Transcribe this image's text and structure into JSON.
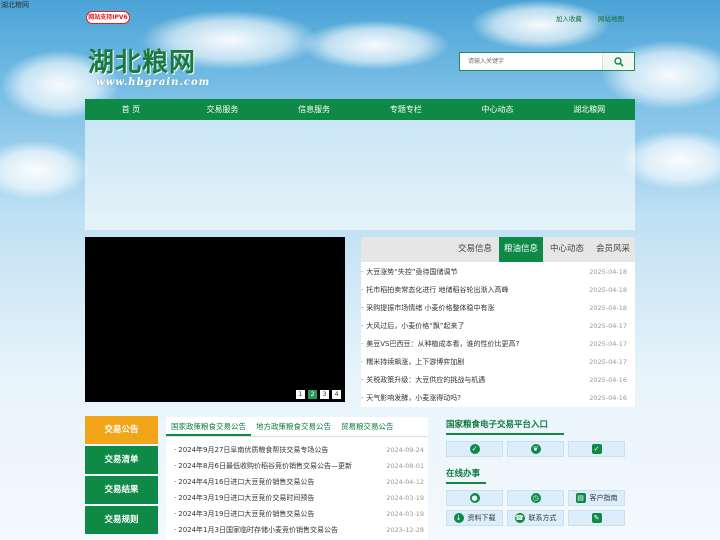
{
  "window_title": "湖北粮网",
  "badge": "网站支持IPV6",
  "toplinks": [
    "加入收藏",
    "网站地图"
  ],
  "logo": {
    "cn": "湖北粮网",
    "en": "www.hbgrain.com"
  },
  "search": {
    "placeholder": "请输入关键字",
    "icon": "search-icon"
  },
  "nav": [
    "首 页",
    "交易服务",
    "信息服务",
    "专题专栏",
    "中心动态",
    "湖北粮网"
  ],
  "video": {
    "pages": [
      "1",
      "2",
      "3",
      "4"
    ],
    "current_page": "2"
  },
  "news": {
    "tabs": [
      "交易信息",
      "粮油信息",
      "中心动态",
      "会员风采"
    ],
    "active_tab": "粮油信息",
    "items": [
      {
        "title": "大豆涨势“失控”亟待国储调节",
        "date": "2025-04-18"
      },
      {
        "title": "托市稻拍卖常态化进行 地储稻谷轮出渐入高峰",
        "date": "2025-04-18"
      },
      {
        "title": "采购提振市场情绪 小麦价格整体稳中有涨",
        "date": "2025-04-18"
      },
      {
        "title": "大风过后，小麦价格“飘”起来了",
        "date": "2025-04-17"
      },
      {
        "title": "美豆VS巴西豆：从种植成本看，谁的性价比更高?",
        "date": "2025-04-17"
      },
      {
        "title": "糯米持续飙涨，上下游博弈加剧",
        "date": "2025-04-17"
      },
      {
        "title": "关税政策升级：大豆供应的挑战与机遇",
        "date": "2025-04-16"
      },
      {
        "title": "天气影响发酵，小麦涨得动吗?",
        "date": "2025-04-16"
      }
    ]
  },
  "sidebox": [
    "交易公告",
    "交易清单",
    "交易结果",
    "交易规则"
  ],
  "notice": {
    "tabs": [
      "国家政策粮食交易公告",
      "地方政策粮食交易公告",
      "贸易粮交易公告"
    ],
    "items": [
      {
        "title": "2024年9月27日阜南优质粮食帮扶交易专场公告",
        "date": "2024-09-24"
      },
      {
        "title": "2024年8月6日最低收购价稻谷竞价销售交易公告—更新",
        "date": "2024-08-01"
      },
      {
        "title": "2024年4月16日进口大豆竞价销售交易公告",
        "date": "2024-04-12"
      },
      {
        "title": "2024年3月19日进口大豆竞价交易时间预告",
        "date": "2024-03-19"
      },
      {
        "title": "2024年3月19日进口大豆竞价销售交易公告",
        "date": "2024-03-19"
      },
      {
        "title": "2024年1月3日国家临时存储小麦竞价销售交易公告",
        "date": "2023-12-28"
      }
    ]
  },
  "platform": {
    "title": "国家粮食电子交易平台入口"
  },
  "banshi": {
    "title": "在线办事",
    "buttons": [
      "客户指南",
      "资料下载",
      "联系方式"
    ]
  }
}
